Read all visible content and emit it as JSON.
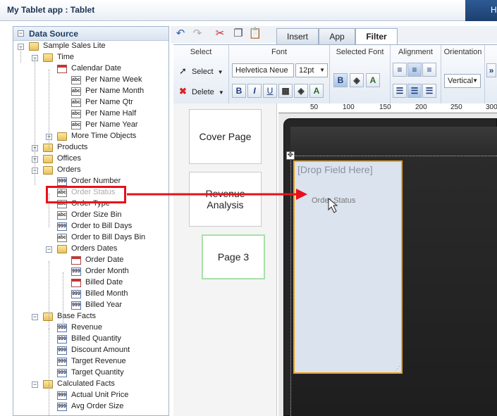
{
  "window": {
    "title": "My Tablet app : Tablet",
    "right_text": "H"
  },
  "data_source": {
    "title": "Data Source",
    "tree": [
      {
        "label": "Sample Sales Lite",
        "icon": "folder",
        "name": "sample-sales-lite"
      },
      {
        "label": "Time",
        "icon": "folder",
        "name": "time-folder"
      },
      {
        "label": "Calendar Date",
        "icon": "calendar",
        "name": "calendar-date"
      },
      {
        "label": "Per Name Week",
        "icon": "abc",
        "name": "per-name-week"
      },
      {
        "label": "Per Name Month",
        "icon": "abc",
        "name": "per-name-month"
      },
      {
        "label": "Per Name Qtr",
        "icon": "abc",
        "name": "per-name-qtr"
      },
      {
        "label": "Per Name Half",
        "icon": "abc",
        "name": "per-name-half"
      },
      {
        "label": "Per Name Year",
        "icon": "abc",
        "name": "per-name-year"
      },
      {
        "label": "More Time Objects",
        "icon": "folder",
        "name": "more-time-objects"
      },
      {
        "label": "Products",
        "icon": "folder",
        "name": "products-folder"
      },
      {
        "label": "Offices",
        "icon": "folder",
        "name": "offices-folder"
      },
      {
        "label": "Orders",
        "icon": "folder",
        "name": "orders-folder"
      },
      {
        "label": "Order Number",
        "icon": "num",
        "name": "order-number"
      },
      {
        "label": "Order Status",
        "icon": "abc",
        "name": "order-status"
      },
      {
        "label": "Order Type",
        "icon": "abc",
        "name": "order-type"
      },
      {
        "label": "Order Size Bin",
        "icon": "abc",
        "name": "order-size-bin"
      },
      {
        "label": "Order to Bill Days",
        "icon": "num",
        "name": "order-to-bill-days"
      },
      {
        "label": "Order to Bill Days Bin",
        "icon": "abc",
        "name": "order-to-bill-days-bin"
      },
      {
        "label": "Orders Dates",
        "icon": "folder",
        "name": "orders-dates"
      },
      {
        "label": "Order Date",
        "icon": "calendar",
        "name": "order-date"
      },
      {
        "label": "Order Month",
        "icon": "num",
        "name": "order-month"
      },
      {
        "label": "Billed Date",
        "icon": "calendar",
        "name": "billed-date"
      },
      {
        "label": "Billed Month",
        "icon": "num",
        "name": "billed-month"
      },
      {
        "label": "Billed Year",
        "icon": "num",
        "name": "billed-year"
      },
      {
        "label": "Base Facts",
        "icon": "folder",
        "name": "base-facts"
      },
      {
        "label": "Revenue",
        "icon": "num",
        "name": "revenue"
      },
      {
        "label": "Billed Quantity",
        "icon": "num",
        "name": "billed-quantity"
      },
      {
        "label": "Discount Amount",
        "icon": "num",
        "name": "discount-amount"
      },
      {
        "label": "Target Revenue",
        "icon": "num",
        "name": "target-revenue"
      },
      {
        "label": "Target Quantity",
        "icon": "num",
        "name": "target-quantity"
      },
      {
        "label": "Calculated Facts",
        "icon": "folder",
        "name": "calculated-facts"
      },
      {
        "label": "Actual Unit Price",
        "icon": "num",
        "name": "actual-unit-price"
      },
      {
        "label": "Avg Order Size",
        "icon": "num",
        "name": "avg-order-size"
      }
    ]
  },
  "tabs": [
    {
      "label": "Insert"
    },
    {
      "label": "App"
    },
    {
      "label": "Filter"
    }
  ],
  "ribbon": {
    "select_group": "Select",
    "select_btn": "Select",
    "delete_btn": "Delete",
    "font_group": "Font",
    "font_name": "Helvetica Neue",
    "font_size": "12pt",
    "selected_font_group": "Selected Font",
    "alignment_group": "Alignment",
    "orientation_group": "Orientation",
    "orientation_value": "Vertical"
  },
  "pages": [
    {
      "label": "Cover Page"
    },
    {
      "label": "Revenue Analysis"
    },
    {
      "label": "Page 3"
    }
  ],
  "ruler": [
    "50",
    "100",
    "150",
    "200",
    "250",
    "300"
  ],
  "canvas": {
    "drop_text": "[Drop Field Here]",
    "drag_label": "Order Status"
  }
}
